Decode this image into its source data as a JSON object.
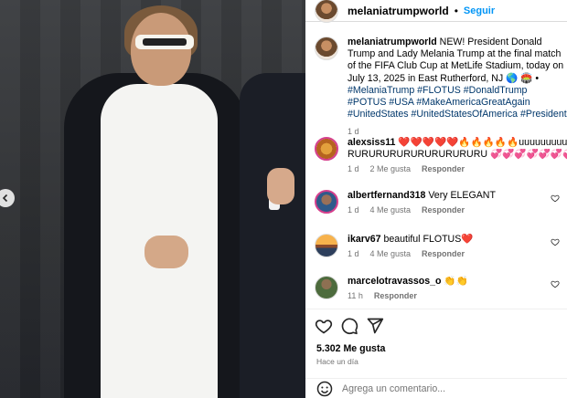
{
  "post": {
    "username": "melaniatrumpworld",
    "follow_label": "Seguir",
    "separator": "•"
  },
  "caption": {
    "username": "melaniatrumpworld",
    "text_before": " NEW! President Donald Trump and Lady Melania Trump at the final match of the FIFA Club Cup at MetLife Stadium, today on July 13, 2025 in East Rutherford, NJ 🌎 🏟️ • ",
    "hashtags": "#MelaniaTrump #FLOTUS #DonaldTrump #POTUS #USA #MakeAmericaGreatAgain #UnitedStates #UnitedStatesOfAmerica #President",
    "age": "1 d"
  },
  "comments": [
    {
      "username": "alexsiss11",
      "text": "❤️❤️❤️❤️❤️🔥🔥🔥🔥🔥uuuuuuuuuuuu",
      "text2": "RURURURURURURURURURU 💞💞💞💞💞💞💞🌷🌷🌷",
      "age": "1 d",
      "likes": "2 Me gusta",
      "reply": "Responder"
    },
    {
      "username": "albertfernand318",
      "text": "Very ELEGANT",
      "age": "1 d",
      "likes": "4 Me gusta",
      "reply": "Responder"
    },
    {
      "username": "ikarv67",
      "text": "beautiful FLOTUS❤️",
      "age": "1 d",
      "likes": "4 Me gusta",
      "reply": "Responder"
    },
    {
      "username": "marcelotravassos_o",
      "text": "👏👏",
      "age": "11 h",
      "reply": "Responder"
    }
  ],
  "actions": {
    "likes_count": "5.302 Me gusta",
    "posted_ago": "Hace un día"
  },
  "composer": {
    "placeholder": "Agrega un comentario..."
  },
  "icons": {
    "like": "heart-icon",
    "comment": "comment-icon",
    "share": "share-icon",
    "emoji": "emoji-icon",
    "prev": "chevron-left-icon"
  },
  "colors": {
    "link": "#0095f6",
    "hashtag": "#00376b",
    "meta": "#737373",
    "story_ring": "#d53f8c"
  }
}
